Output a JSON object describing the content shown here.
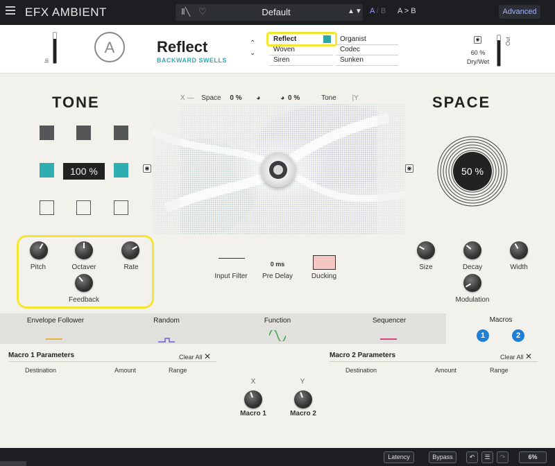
{
  "topbar": {
    "app_title": "EFX AMBIENT",
    "preset_name": "Default",
    "ab_a": "A",
    "ab_sep": "/",
    "ab_b": "B",
    "a_to_b": "A > B",
    "advanced": "Advanced"
  },
  "header": {
    "in_label": "In",
    "out_label": "Out",
    "preset_title": "Reflect",
    "preset_subtitle": "BACKWARD SWELLS",
    "presets": [
      "Reflect",
      "Organist",
      "Woven",
      "Codec",
      "Siren",
      "Sunken"
    ],
    "selected_preset": "Reflect",
    "drywet_value": "60 %",
    "drywet_label": "Dry/Wet",
    "drywet_level": 0.6,
    "in_level": 0.8,
    "out_level": 0.85
  },
  "tone": {
    "title": "TONE",
    "value": "100 %"
  },
  "space": {
    "title": "SPACE",
    "value": "50 %",
    "knobs": [
      "Size",
      "Decay",
      "Width",
      "Modulation"
    ]
  },
  "xy": {
    "x_label": "X",
    "space_label": "Space",
    "space_value": "0 %",
    "tone_value": "0 %",
    "tone_label": "Tone",
    "y_label": "Y"
  },
  "left_knobs": {
    "pitch": "Pitch",
    "octaver": "Octaver",
    "rate": "Rate",
    "feedback": "Feedback"
  },
  "center": {
    "input_filter": "Input Filter",
    "pre_delay_value": "0 ms",
    "pre_delay": "Pre Delay",
    "ducking": "Ducking"
  },
  "tabs": {
    "envelope": "Envelope Follower",
    "random": "Random",
    "function": "Function",
    "sequencer": "Sequencer",
    "macros": "Macros",
    "macro_1": "1",
    "macro_2": "2"
  },
  "macros": {
    "m1_title": "Macro 1 Parameters",
    "m2_title": "Macro 2 Parameters",
    "clear_all": "Clear All",
    "col_destination": "Destination",
    "col_amount": "Amount",
    "col_range": "Range",
    "x_label": "X",
    "y_label": "Y",
    "macro1_label": "Macro 1",
    "macro2_label": "Macro 2"
  },
  "bottom": {
    "latency": "Latency",
    "bypass": "Bypass",
    "cpu": "6%"
  },
  "colors": {
    "accent_teal": "#2eaeb0",
    "highlight_yellow": "#f2e632",
    "macro_blue": "#1e7fd6"
  }
}
